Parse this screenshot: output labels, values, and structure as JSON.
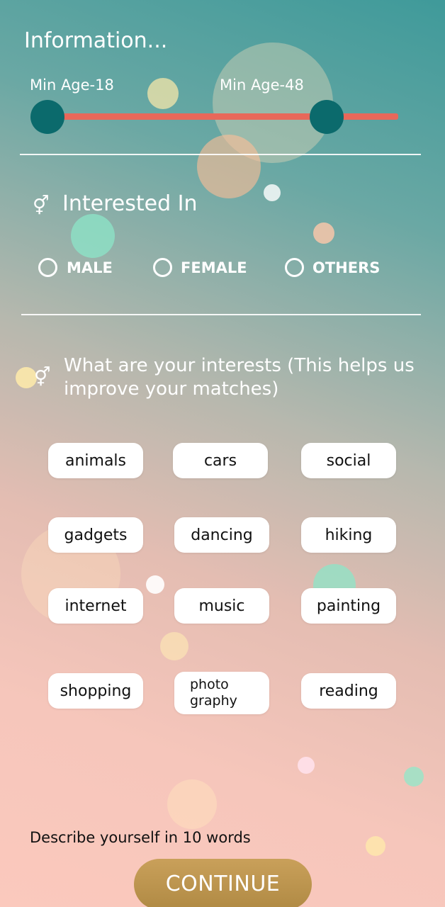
{
  "header": {
    "title": "Information..."
  },
  "age": {
    "min_label": "Min Age-18",
    "max_label": "Min Age-48"
  },
  "interested_in": {
    "icon": "gender-icon",
    "title": "Interested In",
    "options": [
      "MALE",
      "FEMALE",
      "OTHERS"
    ]
  },
  "interests": {
    "icon": "gender-icon",
    "title": "What are your interests (This helps us improve your matches)",
    "chips": [
      "animals",
      "cars",
      "social",
      "gadgets",
      "dancing",
      "hiking",
      "internet",
      "music",
      "painting",
      "shopping",
      "photo\ngraphy",
      "reading"
    ]
  },
  "footer": {
    "describe_label": "Describe yourself in 10 words",
    "continue_label": "CONTINUE"
  },
  "colors": {
    "accent": "#0b6a6c",
    "track": "#e8685a",
    "button": "#b8914c"
  }
}
